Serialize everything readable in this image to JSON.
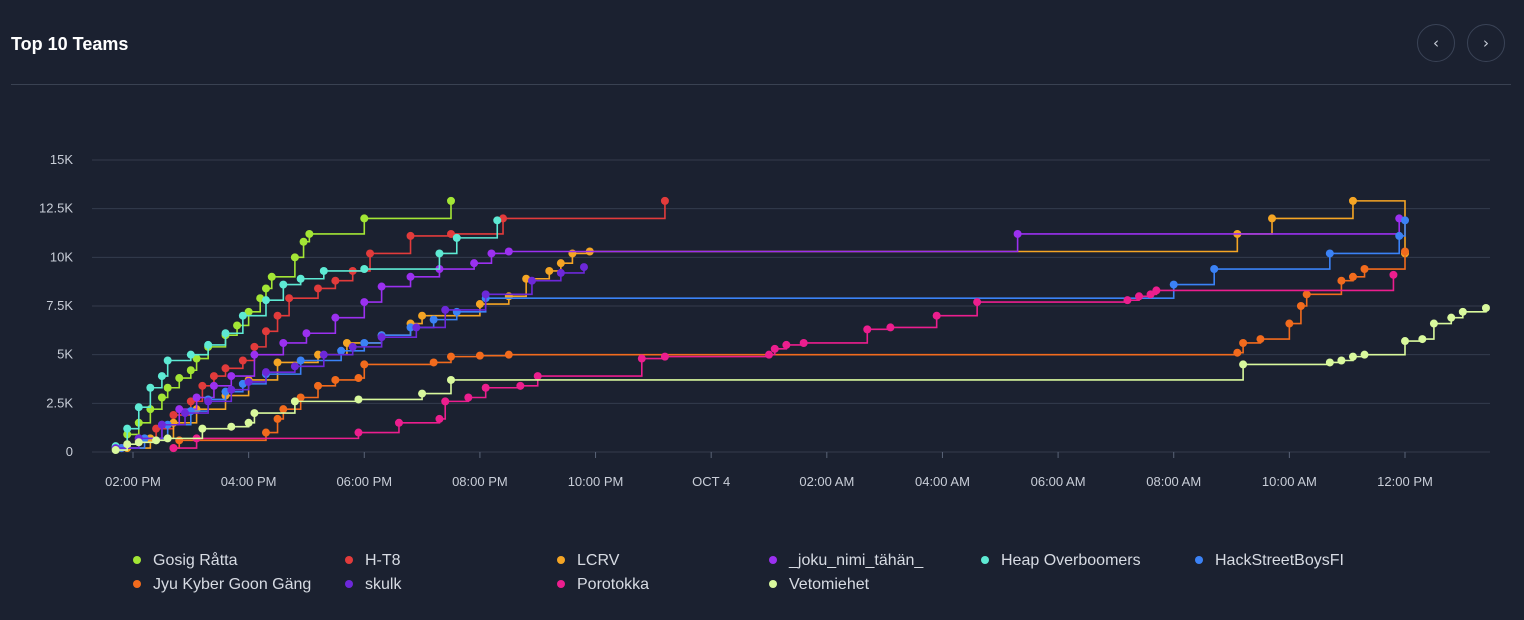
{
  "header": {
    "title": "Top 10 Teams",
    "prev_icon": "chevron-left-icon",
    "next_icon": "chevron-right-icon",
    "prev_glyph": "‹",
    "next_glyph": "›"
  },
  "chart_data": {
    "type": "line",
    "title": "",
    "xlabel": "",
    "ylabel": "",
    "step": true,
    "grid": true,
    "legend_position": "bottom",
    "x_unit": "hours since Oct 3, 12:00 AM",
    "xlim": [
      13.5,
      37.6
    ],
    "ylim": [
      0,
      15000
    ],
    "y_ticks": [
      {
        "value": 0,
        "label": "0"
      },
      {
        "value": 2500,
        "label": "2.5K"
      },
      {
        "value": 5000,
        "label": "5K"
      },
      {
        "value": 7500,
        "label": "7.5K"
      },
      {
        "value": 10000,
        "label": "10K"
      },
      {
        "value": 12500,
        "label": "12.5K"
      },
      {
        "value": 15000,
        "label": "15K"
      }
    ],
    "x_ticks": [
      {
        "value": 14,
        "label": "02:00 PM"
      },
      {
        "value": 16,
        "label": "04:00 PM"
      },
      {
        "value": 18,
        "label": "06:00 PM"
      },
      {
        "value": 20,
        "label": "08:00 PM"
      },
      {
        "value": 22,
        "label": "10:00 PM"
      },
      {
        "value": 24,
        "label": "OCT 4"
      },
      {
        "value": 26,
        "label": "02:00 AM"
      },
      {
        "value": 28,
        "label": "04:00 AM"
      },
      {
        "value": 30,
        "label": "06:00 AM"
      },
      {
        "value": 32,
        "label": "08:00 AM"
      },
      {
        "value": 34,
        "label": "10:00 AM"
      },
      {
        "value": 36,
        "label": "12:00 PM"
      }
    ],
    "series": [
      {
        "name": "Gosig Råtta",
        "color": "#a3e635",
        "points": [
          [
            13.7,
            200
          ],
          [
            13.9,
            900
          ],
          [
            14.1,
            1500
          ],
          [
            14.3,
            2200
          ],
          [
            14.5,
            2800
          ],
          [
            14.6,
            3300
          ],
          [
            14.8,
            3800
          ],
          [
            15.0,
            4200
          ],
          [
            15.1,
            4800
          ],
          [
            15.3,
            5400
          ],
          [
            15.6,
            6000
          ],
          [
            15.8,
            6500
          ],
          [
            16.0,
            7200
          ],
          [
            16.2,
            7900
          ],
          [
            16.3,
            8400
          ],
          [
            16.4,
            9000
          ],
          [
            16.8,
            10000
          ],
          [
            16.95,
            10800
          ],
          [
            17.05,
            11200
          ],
          [
            18.0,
            12000
          ],
          [
            19.5,
            12900
          ]
        ]
      },
      {
        "name": "H-T8",
        "color": "#e23b3b",
        "points": [
          [
            13.8,
            200
          ],
          [
            14.1,
            600
          ],
          [
            14.4,
            1200
          ],
          [
            14.7,
            1900
          ],
          [
            15.0,
            2600
          ],
          [
            15.2,
            3400
          ],
          [
            15.4,
            3900
          ],
          [
            15.6,
            4300
          ],
          [
            15.9,
            4700
          ],
          [
            16.1,
            5400
          ],
          [
            16.3,
            6200
          ],
          [
            16.5,
            7000
          ],
          [
            16.7,
            7900
          ],
          [
            17.2,
            8400
          ],
          [
            17.5,
            8800
          ],
          [
            17.8,
            9300
          ],
          [
            18.1,
            10200
          ],
          [
            18.8,
            11100
          ],
          [
            19.5,
            11200
          ],
          [
            20.4,
            12000
          ],
          [
            23.2,
            12900
          ]
        ]
      },
      {
        "name": "LCRV",
        "color": "#f5a524",
        "points": [
          [
            13.9,
            200
          ],
          [
            14.3,
            700
          ],
          [
            14.7,
            1500
          ],
          [
            15.1,
            2200
          ],
          [
            15.6,
            2900
          ],
          [
            16.0,
            3700
          ],
          [
            16.5,
            4600
          ],
          [
            17.2,
            5000
          ],
          [
            17.7,
            5600
          ],
          [
            18.3,
            6000
          ],
          [
            18.8,
            6600
          ],
          [
            19.0,
            7000
          ],
          [
            20.0,
            7600
          ],
          [
            20.5,
            8000
          ],
          [
            20.8,
            8900
          ],
          [
            21.2,
            9300
          ],
          [
            21.4,
            9700
          ],
          [
            21.6,
            10200
          ],
          [
            21.9,
            10300
          ],
          [
            33.1,
            11200
          ],
          [
            33.7,
            12000
          ],
          [
            35.1,
            12900
          ],
          [
            36.0,
            10200
          ]
        ]
      },
      {
        "name": "_joku_nimi_tähän_",
        "color": "#9b30f0",
        "points": [
          [
            13.8,
            200
          ],
          [
            14.1,
            700
          ],
          [
            14.5,
            1400
          ],
          [
            14.8,
            2200
          ],
          [
            15.1,
            2800
          ],
          [
            15.4,
            3400
          ],
          [
            15.7,
            3900
          ],
          [
            16.1,
            5000
          ],
          [
            16.6,
            5600
          ],
          [
            17.0,
            6100
          ],
          [
            17.5,
            6900
          ],
          [
            18.0,
            7700
          ],
          [
            18.3,
            8500
          ],
          [
            18.8,
            9000
          ],
          [
            19.3,
            9400
          ],
          [
            19.9,
            9700
          ],
          [
            20.2,
            10200
          ],
          [
            20.5,
            10300
          ],
          [
            29.3,
            11200
          ],
          [
            35.9,
            12000
          ]
        ]
      },
      {
        "name": "Heap Overboomers",
        "color": "#5eead4",
        "points": [
          [
            13.7,
            300
          ],
          [
            13.9,
            1200
          ],
          [
            14.1,
            2300
          ],
          [
            14.3,
            3300
          ],
          [
            14.5,
            3900
          ],
          [
            14.6,
            4700
          ],
          [
            15.0,
            5000
          ],
          [
            15.3,
            5500
          ],
          [
            15.6,
            6100
          ],
          [
            15.9,
            7000
          ],
          [
            16.3,
            7800
          ],
          [
            16.6,
            8600
          ],
          [
            16.9,
            8900
          ],
          [
            17.3,
            9300
          ],
          [
            18.0,
            9400
          ],
          [
            19.3,
            10200
          ],
          [
            19.6,
            11000
          ],
          [
            20.3,
            11900
          ]
        ]
      },
      {
        "name": "HackStreetBoysFI",
        "color": "#3b82f6",
        "points": [
          [
            13.8,
            200
          ],
          [
            14.2,
            700
          ],
          [
            14.6,
            1400
          ],
          [
            15.0,
            2100
          ],
          [
            15.3,
            2700
          ],
          [
            15.6,
            3100
          ],
          [
            15.9,
            3500
          ],
          [
            16.3,
            4000
          ],
          [
            16.9,
            4700
          ],
          [
            17.6,
            5200
          ],
          [
            18.0,
            5600
          ],
          [
            18.3,
            6000
          ],
          [
            18.8,
            6400
          ],
          [
            19.2,
            6800
          ],
          [
            19.6,
            7200
          ],
          [
            20.1,
            7900
          ],
          [
            32.0,
            8600
          ],
          [
            32.7,
            9400
          ],
          [
            34.7,
            10200
          ],
          [
            35.9,
            11100
          ],
          [
            36.0,
            11900
          ]
        ]
      },
      {
        "name": "Jyu Kyber Goon Gäng",
        "color": "#f26b1d",
        "points": [
          [
            14.7,
            200
          ],
          [
            14.8,
            600
          ],
          [
            16.3,
            1000
          ],
          [
            16.5,
            1700
          ],
          [
            16.6,
            2200
          ],
          [
            16.9,
            2800
          ],
          [
            17.2,
            3400
          ],
          [
            17.5,
            3700
          ],
          [
            17.9,
            3800
          ],
          [
            18.0,
            4500
          ],
          [
            19.2,
            4600
          ],
          [
            19.5,
            4900
          ],
          [
            20.0,
            4950
          ],
          [
            20.5,
            5000
          ],
          [
            33.1,
            5100
          ],
          [
            33.2,
            5600
          ],
          [
            33.5,
            5800
          ],
          [
            34.0,
            6600
          ],
          [
            34.2,
            7500
          ],
          [
            34.3,
            8100
          ],
          [
            34.9,
            8800
          ],
          [
            35.1,
            9000
          ],
          [
            35.3,
            9400
          ],
          [
            36.0,
            10300
          ]
        ]
      },
      {
        "name": "skulk",
        "color": "#6d28d9",
        "points": [
          [
            13.7,
            200
          ],
          [
            14.1,
            700
          ],
          [
            14.5,
            1400
          ],
          [
            14.9,
            2000
          ],
          [
            15.3,
            2600
          ],
          [
            15.7,
            3200
          ],
          [
            16.0,
            3600
          ],
          [
            16.3,
            4100
          ],
          [
            16.8,
            4400
          ],
          [
            17.3,
            5000
          ],
          [
            17.8,
            5400
          ],
          [
            18.3,
            5900
          ],
          [
            18.9,
            6400
          ],
          [
            19.4,
            7300
          ],
          [
            20.1,
            8100
          ],
          [
            20.9,
            8800
          ],
          [
            21.4,
            9200
          ],
          [
            21.8,
            9500
          ]
        ]
      },
      {
        "name": "Porotokka",
        "color": "#ec1e8e",
        "points": [
          [
            14.7,
            200
          ],
          [
            15.1,
            700
          ],
          [
            17.9,
            1000
          ],
          [
            18.6,
            1500
          ],
          [
            19.3,
            1700
          ],
          [
            19.4,
            2600
          ],
          [
            19.8,
            2800
          ],
          [
            20.1,
            3300
          ],
          [
            20.7,
            3400
          ],
          [
            21.0,
            3900
          ],
          [
            22.8,
            4800
          ],
          [
            23.2,
            4900
          ],
          [
            25.0,
            5000
          ],
          [
            25.1,
            5300
          ],
          [
            25.3,
            5500
          ],
          [
            25.6,
            5600
          ],
          [
            26.7,
            6300
          ],
          [
            27.1,
            6400
          ],
          [
            27.9,
            7000
          ],
          [
            28.6,
            7700
          ],
          [
            31.2,
            7800
          ],
          [
            31.4,
            8000
          ],
          [
            31.6,
            8100
          ],
          [
            31.7,
            8300
          ],
          [
            35.8,
            9100
          ]
        ]
      },
      {
        "name": "Vetomiehet",
        "color": "#d9f99d",
        "points": [
          [
            13.7,
            100
          ],
          [
            13.9,
            400
          ],
          [
            14.1,
            500
          ],
          [
            14.4,
            600
          ],
          [
            14.6,
            700
          ],
          [
            15.2,
            1200
          ],
          [
            15.7,
            1300
          ],
          [
            16.0,
            1500
          ],
          [
            16.1,
            2000
          ],
          [
            16.8,
            2600
          ],
          [
            17.9,
            2700
          ],
          [
            19.0,
            3000
          ],
          [
            19.5,
            3700
          ],
          [
            33.2,
            4500
          ],
          [
            34.7,
            4600
          ],
          [
            34.9,
            4700
          ],
          [
            35.1,
            4900
          ],
          [
            35.3,
            5000
          ],
          [
            36.0,
            5700
          ],
          [
            36.3,
            5800
          ],
          [
            36.5,
            6600
          ],
          [
            36.8,
            6900
          ],
          [
            37.0,
            7200
          ],
          [
            37.4,
            7400
          ]
        ]
      }
    ]
  }
}
